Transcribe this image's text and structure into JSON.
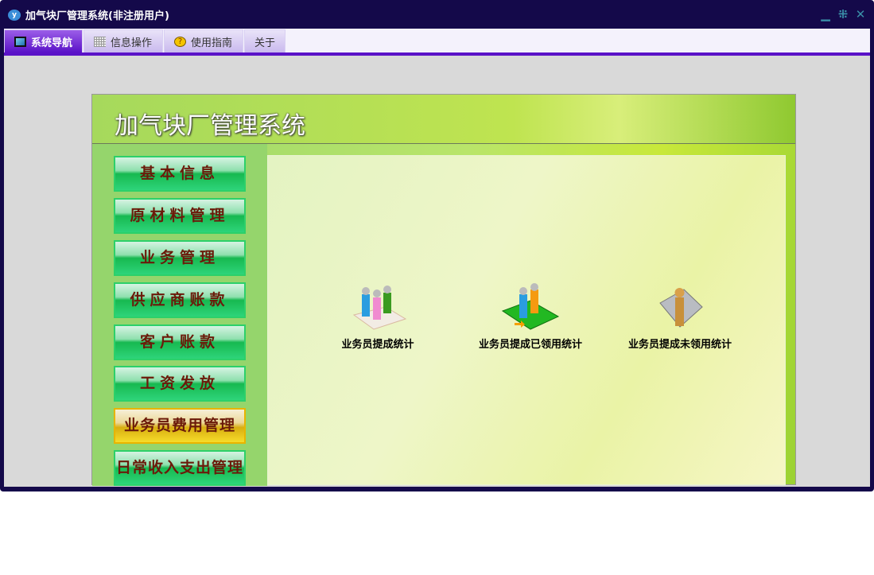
{
  "window": {
    "title": "加气块厂管理系统(非注册用户)"
  },
  "tabs": [
    {
      "label": "系统导航",
      "icon": "monitor-icon"
    },
    {
      "label": "信息操作",
      "icon": "grid-icon"
    },
    {
      "label": "使用指南",
      "icon": "help-icon"
    },
    {
      "label": "关于"
    }
  ],
  "app": {
    "title": "加气块厂管理系统"
  },
  "sidebar": [
    "基本信息",
    "原材料管理",
    "业务管理",
    "供应商账款",
    "客户账款",
    "工资发放",
    "业务员费用管理",
    "日常收入支出管理"
  ],
  "items": [
    {
      "label": "业务员提成统计",
      "icon": "people-group-icon"
    },
    {
      "label": "业务员提成已领用统计",
      "icon": "people-book-icon"
    },
    {
      "label": "业务员提成未领用统计",
      "icon": "person-folder-icon"
    }
  ]
}
